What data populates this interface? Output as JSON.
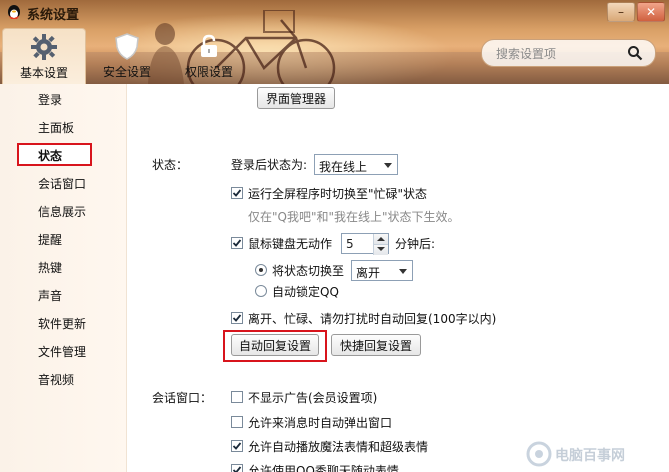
{
  "window": {
    "title": "系统设置"
  },
  "tabs": [
    {
      "label": "基本设置",
      "icon": "gear-icon"
    },
    {
      "label": "安全设置",
      "icon": "shield-icon"
    },
    {
      "label": "权限设置",
      "icon": "lock-icon"
    }
  ],
  "search": {
    "placeholder": "搜索设置项",
    "icon": "search-icon"
  },
  "sidebar": {
    "items": [
      {
        "label": "登录"
      },
      {
        "label": "主面板"
      },
      {
        "label": "状态",
        "selected": true
      },
      {
        "label": "会话窗口"
      },
      {
        "label": "信息展示"
      },
      {
        "label": "提醒"
      },
      {
        "label": "热键"
      },
      {
        "label": "声音"
      },
      {
        "label": "软件更新"
      },
      {
        "label": "文件管理"
      },
      {
        "label": "音视频"
      }
    ]
  },
  "main": {
    "interface_manager_button": "界面管理器",
    "status_section": {
      "heading": "状态：",
      "login_status_label": "登录后状态为:",
      "login_status_value": "我在线上",
      "fullscreen_busy": {
        "label": "运行全屏程序时切换至\"忙碌\"状态",
        "checked": true
      },
      "fullscreen_hint": "仅在\"Q我吧\"和\"我在线上\"状态下生效。",
      "idle": {
        "label": "鼠标键盘无动作",
        "checked": true,
        "minutes": "5",
        "suffix": "分钟后:"
      },
      "switch_status": {
        "label": "将状态切换至",
        "value": "离开",
        "selected": true
      },
      "auto_lock": {
        "label": "自动锁定QQ",
        "selected": false
      },
      "auto_reply": {
        "label": "离开、忙碌、请勿打扰时自动回复(100字以内)",
        "checked": true
      },
      "auto_reply_settings_button": "自动回复设置",
      "quick_reply_settings_button": "快捷回复设置"
    },
    "chat_section": {
      "heading": "会话窗口：",
      "options": [
        {
          "label": "不显示广告(会员设置项)",
          "checked": false
        },
        {
          "label": "允许来消息时自动弹出窗口",
          "checked": false
        },
        {
          "label": "允许自动播放魔法表情和超级表情",
          "checked": true
        },
        {
          "label": "允许使用QQ秀聊天随动表情",
          "checked": true
        }
      ]
    }
  },
  "watermark": {
    "text": "电脑百事网"
  },
  "colors": {
    "highlight_red": "#d8141c",
    "header": "#d9a066"
  }
}
